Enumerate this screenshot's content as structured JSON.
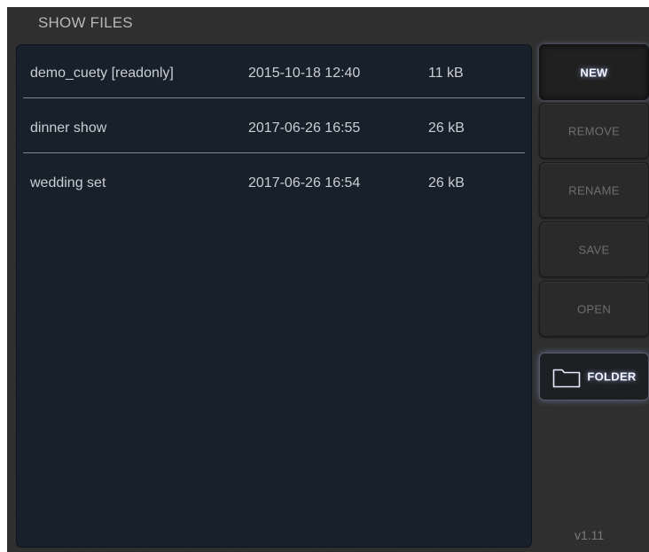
{
  "header": {
    "title": "SHOW FILES"
  },
  "files": [
    {
      "name": "demo_cuety [readonly]",
      "modified": "2015-10-18 12:40",
      "size": "11 kB"
    },
    {
      "name": "dinner show",
      "modified": "2017-06-26 16:55",
      "size": "26 kB"
    },
    {
      "name": "wedding set",
      "modified": "2017-06-26 16:54",
      "size": "26 kB"
    }
  ],
  "actions": {
    "new_label": "NEW",
    "remove_label": "REMOVE",
    "rename_label": "RENAME",
    "save_label": "SAVE",
    "open_label": "OPEN",
    "folder_label": "FOLDER"
  },
  "icons": {
    "folder": "folder-icon"
  },
  "footer": {
    "version": "v1.11"
  },
  "colors": {
    "background": "#2e2e2e",
    "panel": "#18212b",
    "text": "#c9ced3",
    "accent_glow": "#aabeff",
    "disabled_text": "#6e6e6e"
  }
}
